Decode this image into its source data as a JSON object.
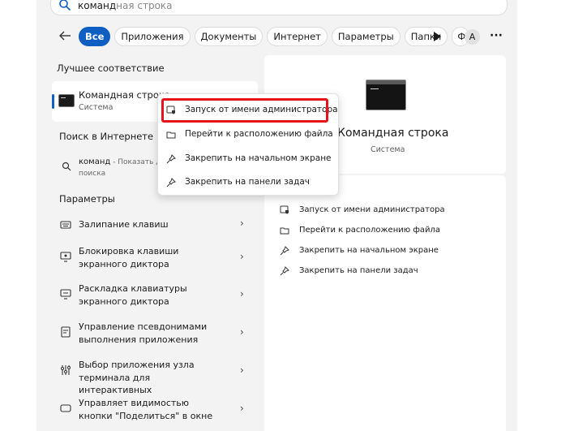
{
  "search": {
    "typed": "команд",
    "suggestion": "ная строка"
  },
  "tabs": [
    {
      "label": "Все",
      "active": true
    },
    {
      "label": "Приложения"
    },
    {
      "label": "Документы"
    },
    {
      "label": "Интернет"
    },
    {
      "label": "Параметры"
    },
    {
      "label": "Папки"
    },
    {
      "label": "Ф"
    }
  ],
  "header": {
    "avatar_letter": "A",
    "more_label": "···"
  },
  "best_match": {
    "section": "Лучшее соответствие",
    "title": "Командная строка",
    "subtitle": "Система"
  },
  "web": {
    "section": "Поиск в Интернете",
    "query": "команд",
    "hint": " - Показать др",
    "sub": "поиска"
  },
  "settings": {
    "section": "Параметры",
    "items": [
      {
        "label": "Залипание клавиш",
        "icon": "keyboard-icon"
      },
      {
        "label": "Блокировка клавиши экранного диктора",
        "icon": "narrator-lock-icon"
      },
      {
        "label": "Раскладка клавиатуры экранного диктора",
        "icon": "narrator-keyboard-icon"
      },
      {
        "label": "Управление псевдонимами выполнения приложения",
        "icon": "app-alias-icon"
      },
      {
        "label": "Выбор приложения узла терминала для интерактивных",
        "icon": "terminal-host-icon"
      },
      {
        "label": "Управляет видимостью кнопки \"Поделиться\" в окне",
        "icon": "share-visibility-icon"
      }
    ]
  },
  "detail": {
    "title": "Командная строка",
    "subtitle": "Система",
    "actions": [
      {
        "label": "Запуск от имени администратора",
        "icon": "shield-admin-icon"
      },
      {
        "label": "Перейти к расположению файла",
        "icon": "folder-icon"
      },
      {
        "label": "Закрепить на начальном экране",
        "icon": "pin-icon"
      },
      {
        "label": "Закрепить на панели задач",
        "icon": "pin-icon"
      }
    ]
  },
  "context_menu": {
    "items": [
      {
        "label": "Запуск от имени администратора",
        "icon": "shield-admin-icon"
      },
      {
        "label": "Перейти к расположению файла",
        "icon": "folder-icon"
      },
      {
        "label": "Закрепить на начальном экране",
        "icon": "pin-icon"
      },
      {
        "label": "Закрепить на панели задач",
        "icon": "pin-icon"
      }
    ]
  },
  "colors": {
    "accent": "#0f5fc2",
    "highlight": "#e3141b",
    "panel_bg": "#f3f3f3"
  }
}
